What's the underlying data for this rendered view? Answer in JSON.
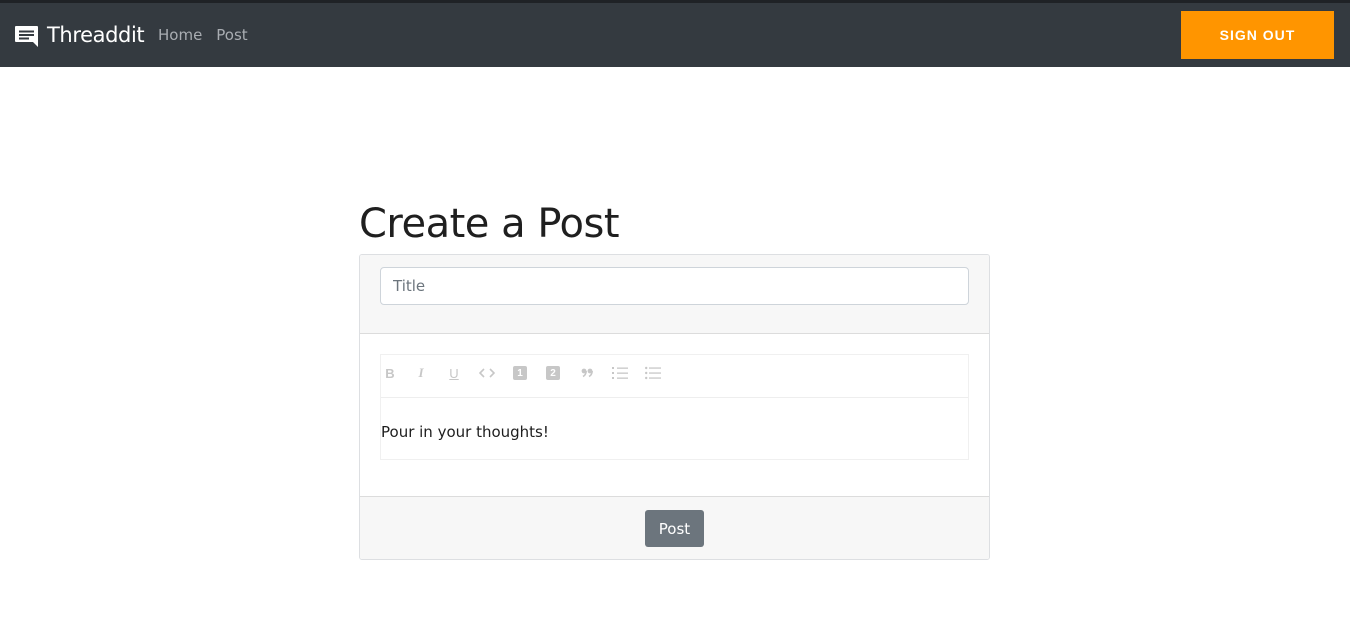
{
  "navbar": {
    "brand": "Threaddit",
    "links": [
      {
        "label": "Home"
      },
      {
        "label": "Post"
      }
    ],
    "signout_label": "SIGN OUT",
    "brand_icon": "chat-bubble-icon",
    "accent_color": "#ff9500",
    "bg_color": "#343a40"
  },
  "page": {
    "title": "Create a Post"
  },
  "form": {
    "title_placeholder": "Title",
    "title_value": "",
    "toolbar": [
      {
        "name": "bold",
        "glyph": "B"
      },
      {
        "name": "italic",
        "glyph": "I"
      },
      {
        "name": "underline",
        "glyph": "U"
      },
      {
        "name": "code",
        "glyph": "<>"
      },
      {
        "name": "heading-1",
        "glyph": "1"
      },
      {
        "name": "heading-2",
        "glyph": "2"
      },
      {
        "name": "blockquote",
        "glyph": "”"
      },
      {
        "name": "ordered-list",
        "glyph": ""
      },
      {
        "name": "bullet-list",
        "glyph": ""
      }
    ],
    "editor_placeholder": "Pour in your thoughts!",
    "submit_label": "Post"
  }
}
